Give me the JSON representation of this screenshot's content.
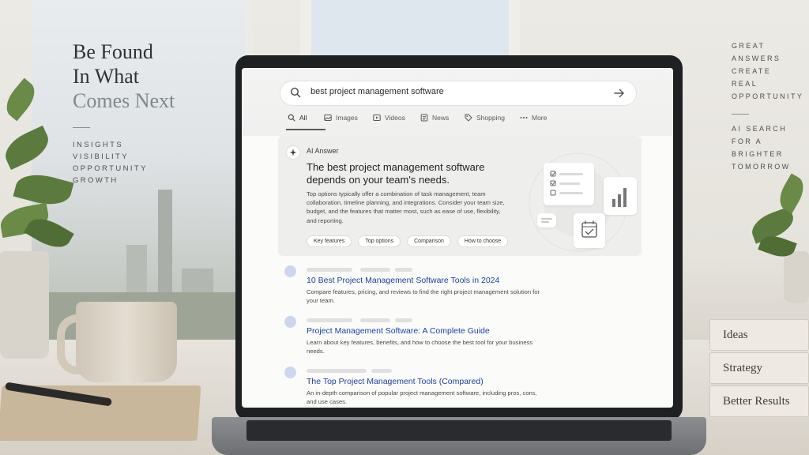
{
  "left_copy": {
    "headline_line1": "Be Found",
    "headline_line2": "In What",
    "headline_line3": "Comes Next",
    "keywords": [
      "INSIGHTS",
      "VISIBILITY",
      "OPPORTUNITY",
      "GROWTH"
    ]
  },
  "right_copy": {
    "tagline": [
      "GREAT",
      "ANSWERS",
      "CREATE",
      "REAL",
      "OPPORTUNITY"
    ],
    "subline": [
      "AI SEARCH",
      "FOR A BRIGHTER",
      "TOMORROW"
    ]
  },
  "books": [
    "Ideas",
    "Strategy",
    "Better Results"
  ],
  "search": {
    "query": "best project management software",
    "search_icon": "search-icon",
    "submit_icon": "arrow-right-icon"
  },
  "tabs": [
    {
      "label": "All",
      "icon": "search-icon",
      "active": true
    },
    {
      "label": "Images",
      "icon": "image-icon",
      "active": false
    },
    {
      "label": "Videos",
      "icon": "play-icon",
      "active": false
    },
    {
      "label": "News",
      "icon": "newspaper-icon",
      "active": false
    },
    {
      "label": "Shopping",
      "icon": "tag-icon",
      "active": false
    },
    {
      "label": "More",
      "icon": "dots-icon",
      "active": false
    }
  ],
  "ai_answer": {
    "label": "AI Answer",
    "title": "The best project management software depends on your team's needs.",
    "body": "Top options typically offer a combination of task management, team collaboration, timeline planning, and integrations. Consider your team size, budget, and the features that matter most, such as ease of use, flexibility, and reporting.",
    "chips": [
      "Key features",
      "Top options",
      "Comparison",
      "How to choose"
    ]
  },
  "results": [
    {
      "title": "10 Best Project Management Software Tools in 2024",
      "snippet": "Compare features, pricing, and reviews to find the right project management solution for your team."
    },
    {
      "title": "Project Management Software: A Complete Guide",
      "snippet": "Learn about key features, benefits, and how to choose the best tool for your business needs."
    },
    {
      "title": "The Top Project Management Tools (Compared)",
      "snippet": "An in-depth comparison of popular project management software, including pros, cons, and use cases."
    }
  ],
  "colors": {
    "link": "#1f3fa6",
    "plant": "#5b7a3e",
    "screen_bg": "#fbfbfa",
    "ai_panel_bg": "#eeefed"
  }
}
